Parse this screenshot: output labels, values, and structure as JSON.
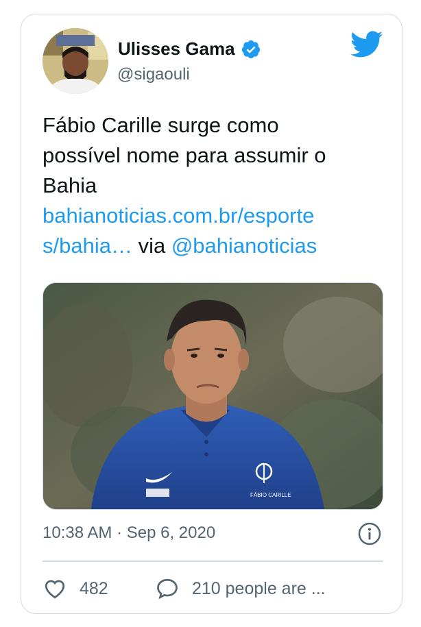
{
  "author": {
    "name": "Ulisses Gama",
    "handle": "@sigaouli",
    "verified": true
  },
  "tweet": {
    "line1": "Fábio Carille surge como",
    "line2": "possível nome para assumir o",
    "line3": "Bahia",
    "link_line1": "bahianoticias.com.br/esporte",
    "link_line2": "s/bahia…",
    "via_text": " via ",
    "mention": "@bahianoticias"
  },
  "media": {
    "shirt_text": "FÁBIO CARILLE"
  },
  "meta": {
    "timestamp": "10:38 AM · Sep 6, 2020"
  },
  "actions": {
    "likes": "482",
    "replies_label": "210 people are ..."
  },
  "colors": {
    "link": "#1d9bf0",
    "text": "#0f1419",
    "secondary": "#536471",
    "border": "#cfd9de"
  },
  "icons": [
    "verified-badge-icon",
    "twitter-bird-icon",
    "info-icon",
    "heart-icon",
    "reply-icon"
  ]
}
